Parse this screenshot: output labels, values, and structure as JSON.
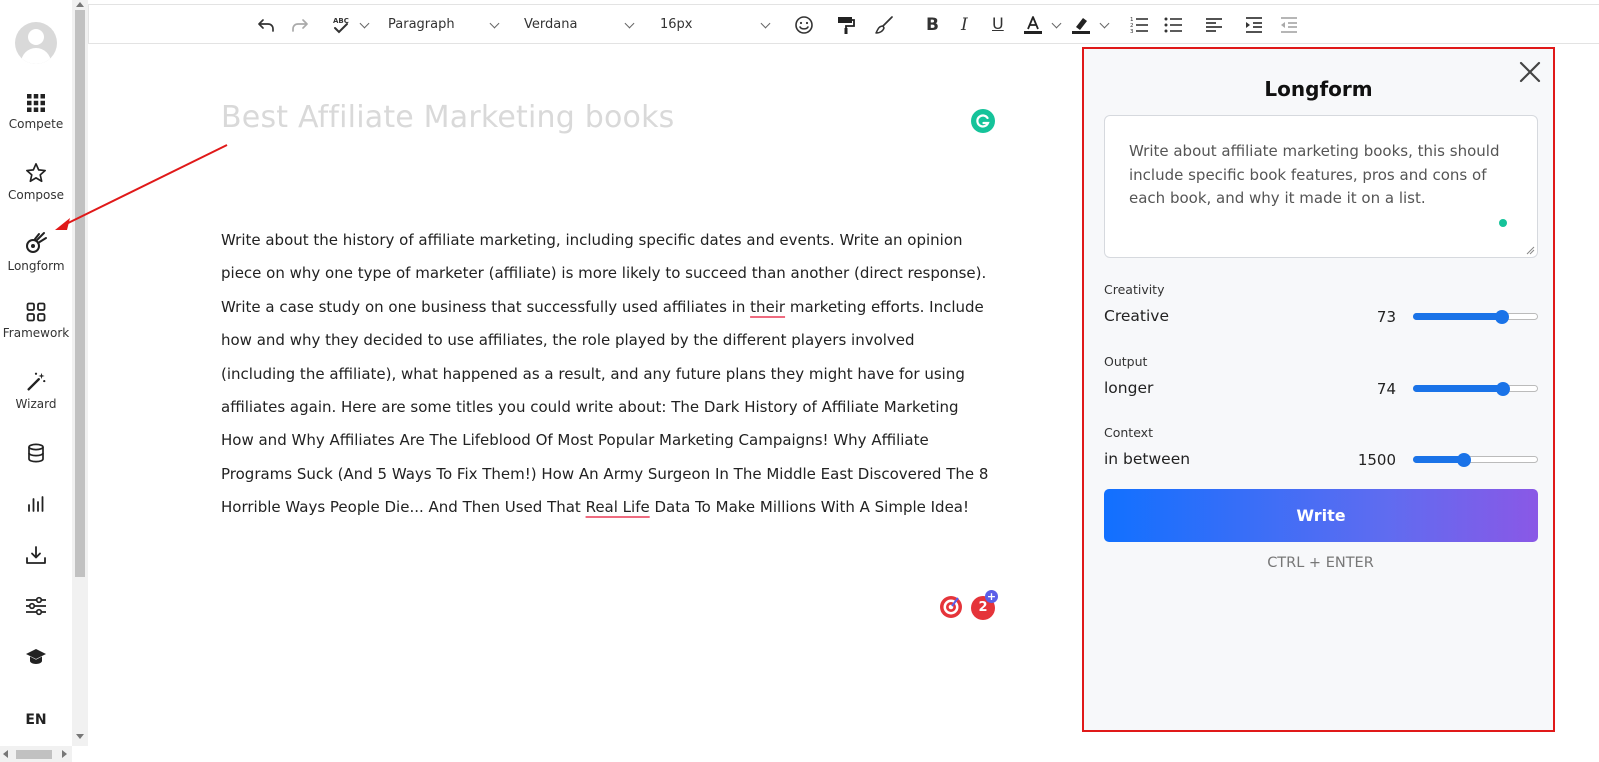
{
  "sidebar": {
    "items": [
      {
        "label": "Compete",
        "icon": "grid-icon"
      },
      {
        "label": "Compose",
        "icon": "star-icon"
      },
      {
        "label": "Longform",
        "icon": "comet-icon"
      },
      {
        "label": "Framework",
        "icon": "framework-icon"
      },
      {
        "label": "Wizard",
        "icon": "magic-wand-icon"
      }
    ],
    "extra_icons": [
      "database-icon",
      "bar-chart-icon",
      "download-icon",
      "sliders-icon",
      "graduation-cap-icon"
    ],
    "language": "EN"
  },
  "toolbar": {
    "block_format": "Paragraph",
    "font_family": "Verdana",
    "font_size": "16px"
  },
  "editor": {
    "title": "Best Affiliate Marketing books",
    "body_part1": "Write about the history of affiliate marketing, including specific dates and events. Write an opinion piece on why one type of marketer (affiliate) is more likely to succeed than another (direct response). Write a case study on one business that successfully used affiliates in ",
    "body_flag1": "their",
    "body_part2": " marketing efforts. Include how and why they decided to use affiliates, the role played by the different players involved (including the affiliate), what happened as a result, and any future plans they might have for using affiliates again. Here are some titles you could write about: The Dark History of Affiliate Marketing How and Why Affiliates Are The Lifeblood Of Most Popular Marketing Campaigns! Why Affiliate Programs Suck (And 5 Ways To Fix Them!) How An Army Surgeon In The Middle East Discovered The 8 Horrible Ways People Die... And Then Used That ",
    "body_flag2": "Real Life",
    "body_part3": " Data To Make Millions With A Simple Idea!",
    "issue_count": "2"
  },
  "panel": {
    "title": "Longform",
    "prompt": "Write about affiliate marketing books, this should include specific book features, pros and cons of each book, and why it made it on a list.",
    "controls": [
      {
        "label": "Creativity",
        "value_text": "Creative",
        "number": "73",
        "level": 0.71
      },
      {
        "label": "Output",
        "value_text": "longer",
        "number": "74",
        "level": 0.72
      },
      {
        "label": "Context",
        "value_text": "in between",
        "number": "1500",
        "level": 0.41
      }
    ],
    "write_label": "Write",
    "shortcut": "CTRL + ENTER"
  },
  "colors": {
    "accent": "#1a73e8",
    "highlight_border": "#e01919",
    "grammarly": "#15c39a"
  }
}
